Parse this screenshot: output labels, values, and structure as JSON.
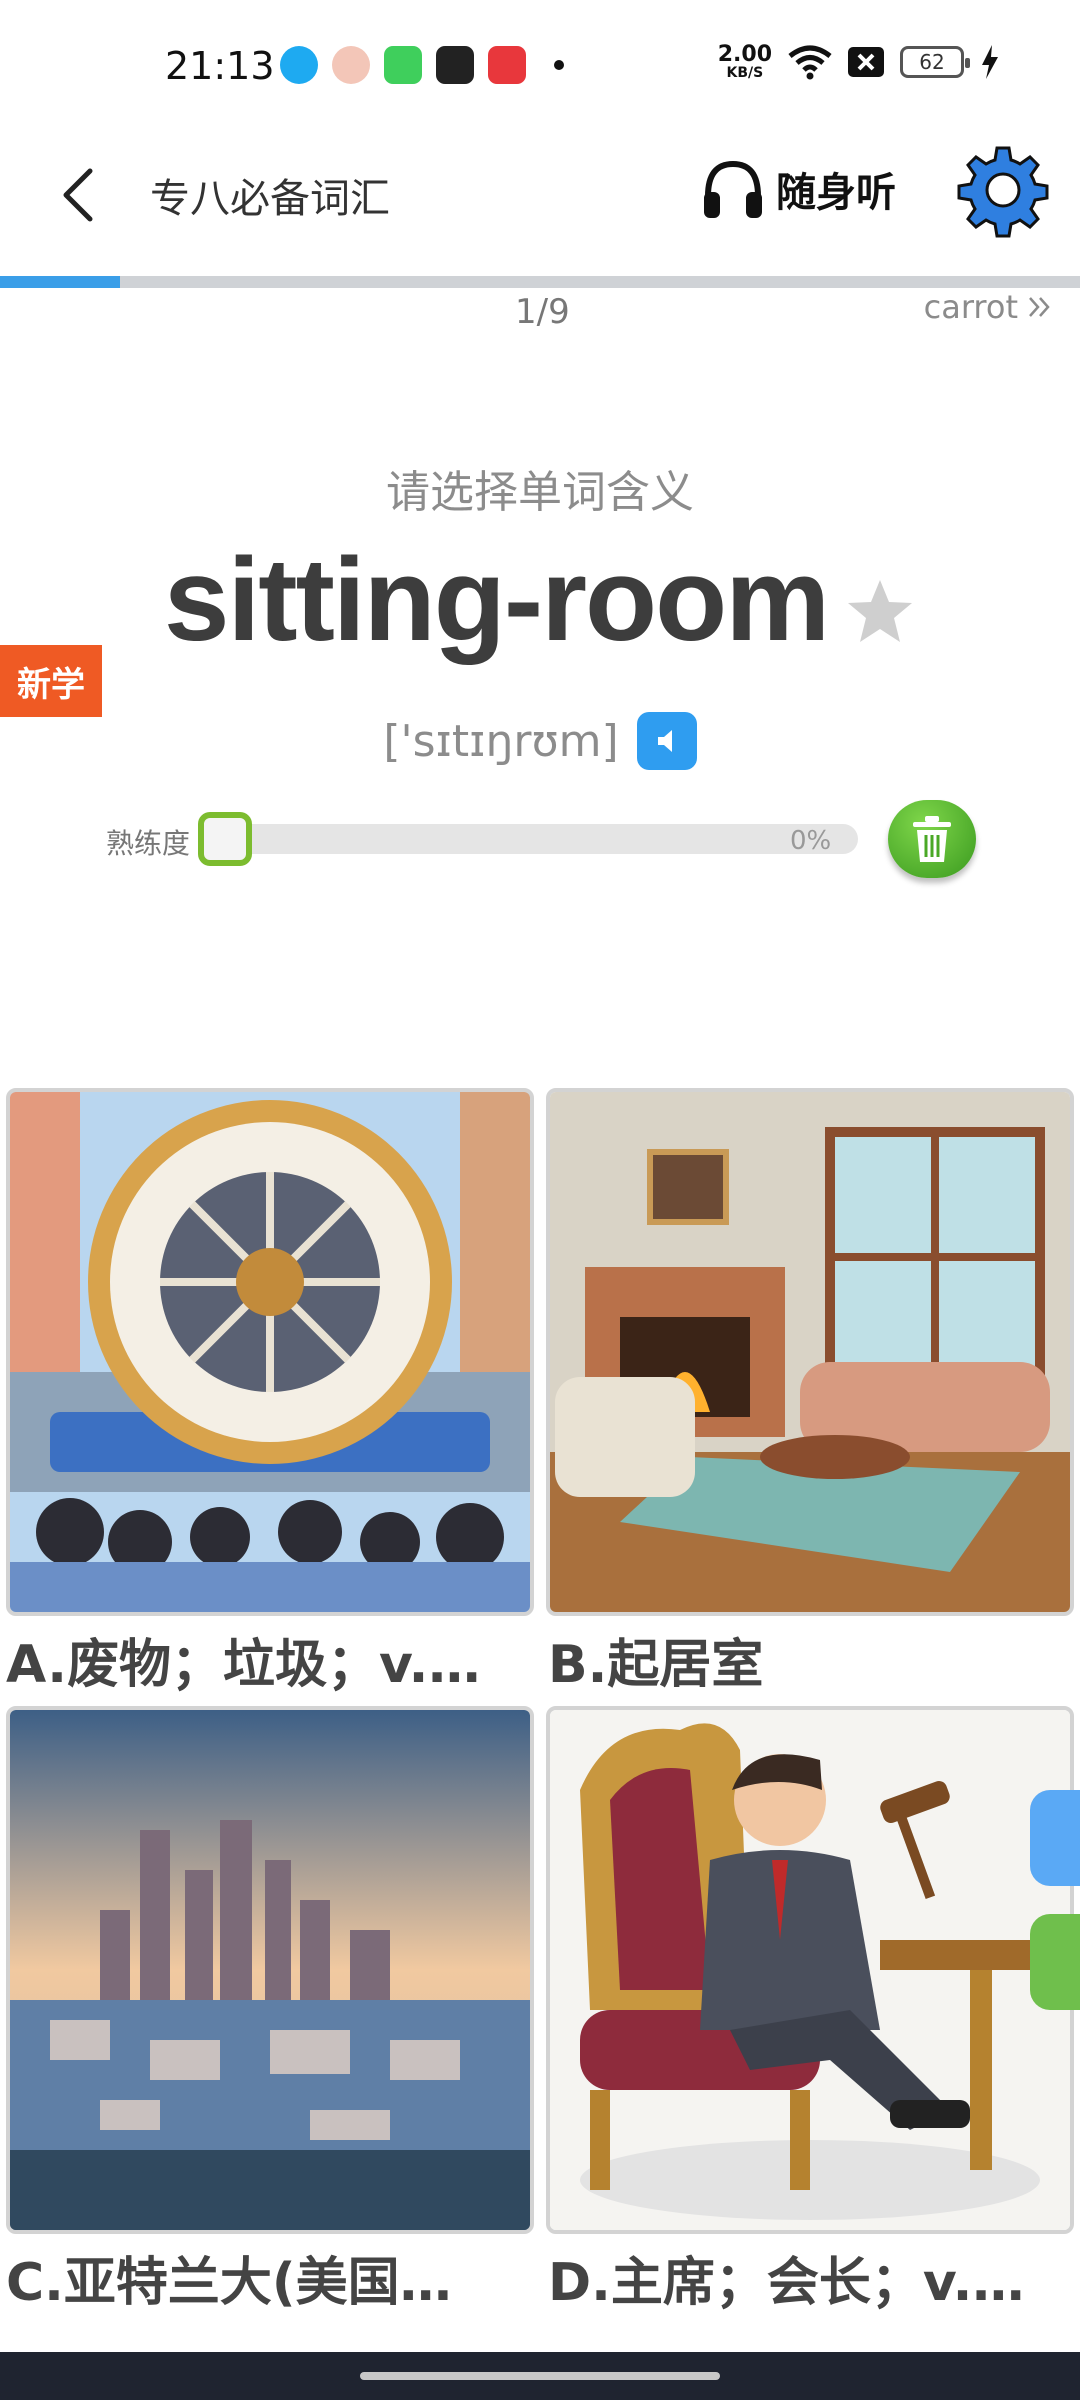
{
  "status": {
    "time": "21:13",
    "net_speed_value": "2.00",
    "net_speed_unit": "KB/S",
    "battery": "62"
  },
  "header": {
    "title": "专八必备词汇",
    "listen_label": "随身听",
    "back_icon": "back-arrow-icon",
    "settings_icon": "gear-icon"
  },
  "progress": {
    "counter": "1/9",
    "fraction": 0.111,
    "next_word": "carrot"
  },
  "question": {
    "prompt": "请选择单词含义",
    "word": "sitting-room",
    "phonetic": "['sɪtɪŋrʊm]",
    "badge": "新学"
  },
  "proficiency": {
    "label": "熟练度",
    "value": "0%"
  },
  "options": [
    {
      "label": "A.废物；垃圾；v.…"
    },
    {
      "label": "B.起居室"
    },
    {
      "label": "C.亚特兰大(美国…"
    },
    {
      "label": "D.主席；会长；v.…"
    }
  ],
  "colors": {
    "accent_blue": "#3a9ee8",
    "badge_orange": "#ef5a24",
    "proficiency_green": "#7cbc2f",
    "trash_green": "#3a9a1f"
  }
}
